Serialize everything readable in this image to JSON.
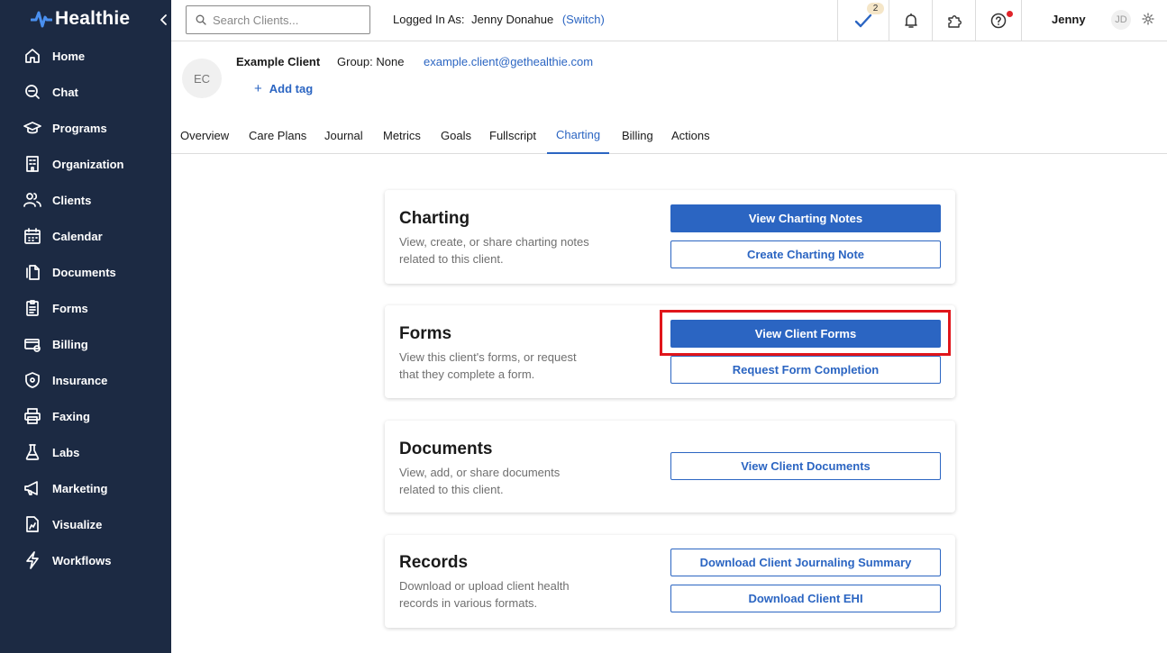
{
  "app": {
    "logo_text": "Healthie"
  },
  "sidebar": {
    "items": [
      {
        "label": "Home",
        "icon": "home-icon"
      },
      {
        "label": "Chat",
        "icon": "chat-icon"
      },
      {
        "label": "Programs",
        "icon": "graduation-cap-icon"
      },
      {
        "label": "Organization",
        "icon": "building-icon"
      },
      {
        "label": "Clients",
        "icon": "users-icon"
      },
      {
        "label": "Calendar",
        "icon": "calendar-icon"
      },
      {
        "label": "Documents",
        "icon": "documents-icon"
      },
      {
        "label": "Forms",
        "icon": "clipboard-icon"
      },
      {
        "label": "Billing",
        "icon": "billing-icon"
      },
      {
        "label": "Insurance",
        "icon": "shield-icon"
      },
      {
        "label": "Faxing",
        "icon": "printer-icon"
      },
      {
        "label": "Labs",
        "icon": "flask-icon"
      },
      {
        "label": "Marketing",
        "icon": "megaphone-icon"
      },
      {
        "label": "Visualize",
        "icon": "chart-file-icon"
      },
      {
        "label": "Workflows",
        "icon": "lightning-icon"
      }
    ]
  },
  "topbar": {
    "search_placeholder": "Search Clients...",
    "logged_in_label": "Logged In As:",
    "logged_in_user": "Jenny Donahue",
    "switch_label": "(Switch)",
    "tasks_badge": "2",
    "user_name": "Jenny",
    "user_initials": "JD"
  },
  "client": {
    "initials": "EC",
    "name": "Example Client",
    "group": "Group: None",
    "email": "example.client@gethealthie.com",
    "add_tag_label": "Add tag"
  },
  "tabs": [
    "Overview",
    "Care Plans",
    "Journal",
    "Metrics",
    "Goals",
    "Fullscript",
    "Charting",
    "Billing",
    "Actions"
  ],
  "active_tab": "Charting",
  "cards": {
    "charting": {
      "title": "Charting",
      "desc": "View, create, or share charting notes related to this client.",
      "btn1": "View Charting Notes",
      "btn2": "Create Charting Note"
    },
    "forms": {
      "title": "Forms",
      "desc": "View this client's forms, or request that they complete a form.",
      "btn1": "View Client Forms",
      "btn2": "Request Form Completion"
    },
    "documents": {
      "title": "Documents",
      "desc": "View, add, or share documents related to this client.",
      "btn1": "View Client Documents"
    },
    "records": {
      "title": "Records",
      "desc": "Download or upload client health records in various formats.",
      "btn1": "Download Client Journaling Summary",
      "btn2": "Download Client EHI"
    }
  },
  "colors": {
    "sidebar_bg": "#1c2a43",
    "accent": "#2b65c2",
    "highlight": "#e0151b",
    "logo_blue": "#4a90f0"
  }
}
